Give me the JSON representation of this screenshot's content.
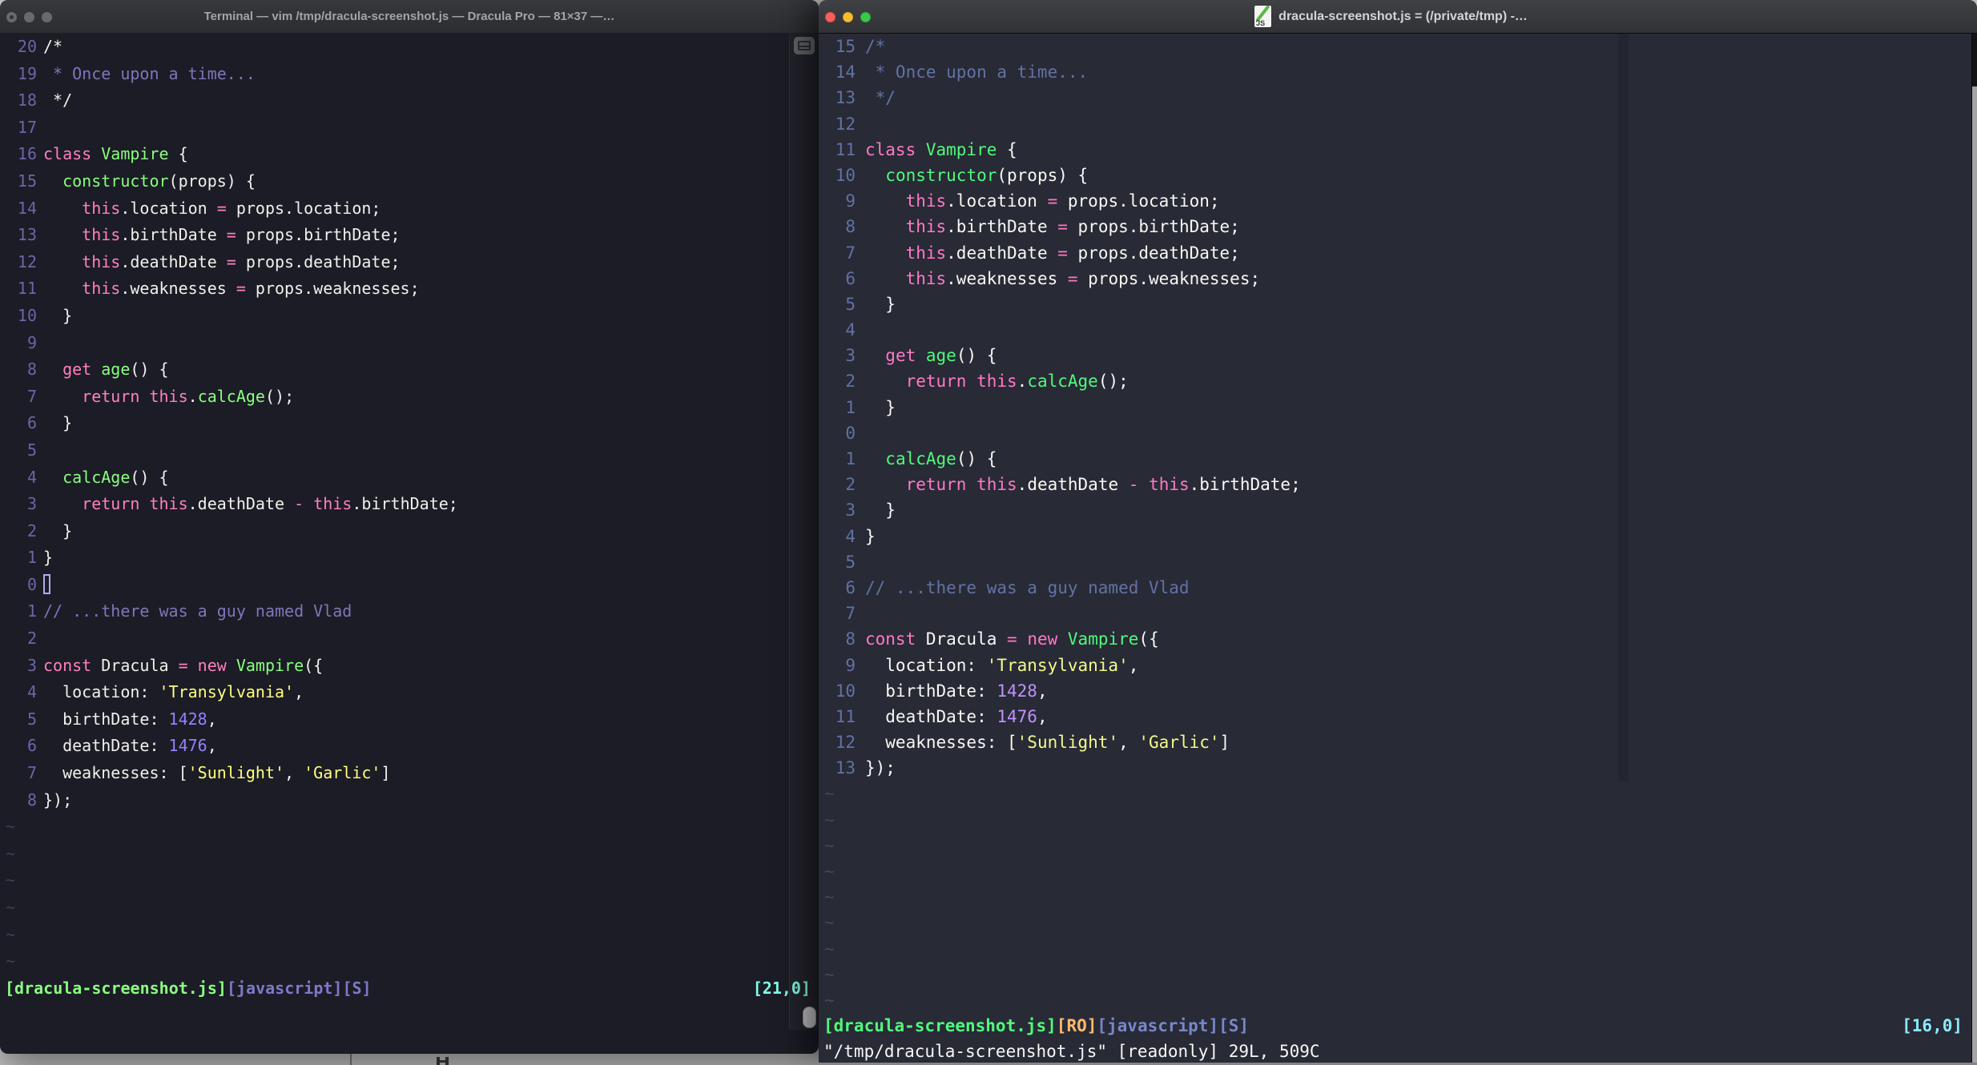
{
  "palette": {
    "lw": {
      "bg": "#1b1c25",
      "fg": "#f1f0ec",
      "pink": "#ff80bf",
      "green": "#8aff80",
      "yellow": "#ffff80",
      "purple": "#9580ff",
      "cyan": "#80ffea",
      "comment": "#7e76bb",
      "line_number": "#6c65a9",
      "tilde": "#3e3f4e",
      "cursor_outline": "#b3a9ee",
      "status_file": "#8aff80",
      "status_meta": "#7e79c9",
      "status_ruler": "#80ffea"
    },
    "rw": {
      "bg": "#282a36",
      "fg": "#f8f8f2",
      "pink": "#ff79c6",
      "green": "#50fa7b",
      "yellow": "#f1fa8c",
      "purple": "#bd93f9",
      "cyan": "#8be9fd",
      "orange": "#ffb86c",
      "comment": "#6272a4",
      "line_number": "#6272a4",
      "tilde": "#44475a",
      "colorcolumn": "#232531",
      "status_file": "#50fa7b",
      "status_meta": "#7787c9",
      "status_ruler": "#8be9fd"
    },
    "traffic_lights": {
      "inactive": "#68696b",
      "red": "#f9605a",
      "yellow": "#f8bd2f",
      "green": "#3bc84a"
    }
  },
  "left_window": {
    "title": "Terminal — vim /tmp/dracula-screenshot.js — Dracula Pro — 81×37 —…",
    "theme": "Dracula Pro",
    "tilde_rows": 6,
    "status": {
      "file": "[dracula-screenshot.js]",
      "meta": "[javascript][S]",
      "ruler": "[21,0]"
    },
    "lines": [
      {
        "n": "20",
        "t": [
          [
            "fg",
            "/*"
          ]
        ]
      },
      {
        "n": "19",
        "t": [
          [
            "comment",
            " * Once upon a time..."
          ]
        ]
      },
      {
        "n": "18",
        "t": [
          [
            "fg",
            " */"
          ]
        ]
      },
      {
        "n": "17",
        "t": []
      },
      {
        "n": "16",
        "t": [
          [
            "pink",
            "class "
          ],
          [
            "green",
            "Vampire"
          ],
          [
            "fg",
            " {"
          ]
        ]
      },
      {
        "n": "15",
        "t": [
          [
            "fg",
            "  "
          ],
          [
            "green",
            "constructor"
          ],
          [
            "fg",
            "(props) {"
          ]
        ]
      },
      {
        "n": "14",
        "t": [
          [
            "fg",
            "    "
          ],
          [
            "pink",
            "this"
          ],
          [
            "fg",
            ".location "
          ],
          [
            "pink",
            "="
          ],
          [
            "fg",
            " props.location;"
          ]
        ]
      },
      {
        "n": "13",
        "t": [
          [
            "fg",
            "    "
          ],
          [
            "pink",
            "this"
          ],
          [
            "fg",
            ".birthDate "
          ],
          [
            "pink",
            "="
          ],
          [
            "fg",
            " props.birthDate;"
          ]
        ]
      },
      {
        "n": "12",
        "t": [
          [
            "fg",
            "    "
          ],
          [
            "pink",
            "this"
          ],
          [
            "fg",
            ".deathDate "
          ],
          [
            "pink",
            "="
          ],
          [
            "fg",
            " props.deathDate;"
          ]
        ]
      },
      {
        "n": "11",
        "t": [
          [
            "fg",
            "    "
          ],
          [
            "pink",
            "this"
          ],
          [
            "fg",
            ".weaknesses "
          ],
          [
            "pink",
            "="
          ],
          [
            "fg",
            " props.weaknesses;"
          ]
        ]
      },
      {
        "n": "10",
        "t": [
          [
            "fg",
            "  }"
          ]
        ]
      },
      {
        "n": "9",
        "t": []
      },
      {
        "n": "8",
        "t": [
          [
            "fg",
            "  "
          ],
          [
            "pink",
            "get "
          ],
          [
            "green",
            "age"
          ],
          [
            "fg",
            "() {"
          ]
        ]
      },
      {
        "n": "7",
        "t": [
          [
            "fg",
            "    "
          ],
          [
            "pink",
            "return "
          ],
          [
            "pink",
            "this"
          ],
          [
            "fg",
            "."
          ],
          [
            "green",
            "calcAge"
          ],
          [
            "fg",
            "();"
          ]
        ]
      },
      {
        "n": "6",
        "t": [
          [
            "fg",
            "  }"
          ]
        ]
      },
      {
        "n": "5",
        "t": []
      },
      {
        "n": "4",
        "t": [
          [
            "fg",
            "  "
          ],
          [
            "green",
            "calcAge"
          ],
          [
            "fg",
            "() {"
          ]
        ]
      },
      {
        "n": "3",
        "t": [
          [
            "fg",
            "    "
          ],
          [
            "pink",
            "return "
          ],
          [
            "pink",
            "this"
          ],
          [
            "fg",
            ".deathDate "
          ],
          [
            "pink",
            "-"
          ],
          [
            "fg",
            " "
          ],
          [
            "pink",
            "this"
          ],
          [
            "fg",
            ".birthDate;"
          ]
        ]
      },
      {
        "n": "2",
        "t": [
          [
            "fg",
            "  }"
          ]
        ]
      },
      {
        "n": "1",
        "t": [
          [
            "fg",
            "}"
          ]
        ]
      },
      {
        "n": "0",
        "t": [],
        "cursor": true
      },
      {
        "n": "1",
        "t": [
          [
            "comment",
            "// ...there was a guy named Vlad"
          ]
        ]
      },
      {
        "n": "2",
        "t": []
      },
      {
        "n": "3",
        "t": [
          [
            "pink",
            "const "
          ],
          [
            "fg",
            "Dracula "
          ],
          [
            "pink",
            "="
          ],
          [
            "fg",
            " "
          ],
          [
            "pink",
            "new "
          ],
          [
            "green",
            "Vampire"
          ],
          [
            "fg",
            "({"
          ]
        ]
      },
      {
        "n": "4",
        "t": [
          [
            "fg",
            "  location: "
          ],
          [
            "yellow",
            "'Transylvania'"
          ],
          [
            "fg",
            ","
          ]
        ]
      },
      {
        "n": "5",
        "t": [
          [
            "fg",
            "  birthDate: "
          ],
          [
            "purple",
            "1428"
          ],
          [
            "fg",
            ","
          ]
        ]
      },
      {
        "n": "6",
        "t": [
          [
            "fg",
            "  deathDate: "
          ],
          [
            "purple",
            "1476"
          ],
          [
            "fg",
            ","
          ]
        ]
      },
      {
        "n": "7",
        "t": [
          [
            "fg",
            "  weaknesses: ["
          ],
          [
            "yellow",
            "'Sunlight'"
          ],
          [
            "fg",
            ", "
          ],
          [
            "yellow",
            "'Garlic'"
          ],
          [
            "fg",
            "]"
          ]
        ]
      },
      {
        "n": "8",
        "t": [
          [
            "fg",
            "});"
          ]
        ]
      }
    ]
  },
  "right_window": {
    "title": "dracula-screenshot.js = (/private/tmp) - VIM",
    "icon_label": "JS",
    "tilde_rows": 9,
    "status": {
      "file": "[dracula-screenshot.js]",
      "ro": "[RO]",
      "meta": "[javascript][S]",
      "ruler": "[16,0]"
    },
    "message": "\"/tmp/dracula-screenshot.js\" [readonly] 29L, 509C",
    "lines": [
      {
        "n": "15",
        "t": [
          [
            "comment",
            "/*"
          ]
        ]
      },
      {
        "n": "14",
        "t": [
          [
            "comment",
            " * Once upon a time..."
          ]
        ]
      },
      {
        "n": "13",
        "t": [
          [
            "comment",
            " */"
          ]
        ]
      },
      {
        "n": "12",
        "t": []
      },
      {
        "n": "11",
        "t": [
          [
            "pink",
            "class "
          ],
          [
            "green",
            "Vampire"
          ],
          [
            "fg",
            " {"
          ]
        ]
      },
      {
        "n": "10",
        "t": [
          [
            "fg",
            "  "
          ],
          [
            "green",
            "constructor"
          ],
          [
            "fg",
            "(props) {"
          ]
        ]
      },
      {
        "n": "9",
        "t": [
          [
            "fg",
            "    "
          ],
          [
            "pink",
            "this"
          ],
          [
            "fg",
            ".location "
          ],
          [
            "pink",
            "="
          ],
          [
            "fg",
            " props.location;"
          ]
        ]
      },
      {
        "n": "8",
        "t": [
          [
            "fg",
            "    "
          ],
          [
            "pink",
            "this"
          ],
          [
            "fg",
            ".birthDate "
          ],
          [
            "pink",
            "="
          ],
          [
            "fg",
            " props.birthDate;"
          ]
        ]
      },
      {
        "n": "7",
        "t": [
          [
            "fg",
            "    "
          ],
          [
            "pink",
            "this"
          ],
          [
            "fg",
            ".deathDate "
          ],
          [
            "pink",
            "="
          ],
          [
            "fg",
            " props.deathDate;"
          ]
        ]
      },
      {
        "n": "6",
        "t": [
          [
            "fg",
            "    "
          ],
          [
            "pink",
            "this"
          ],
          [
            "fg",
            ".weaknesses "
          ],
          [
            "pink",
            "="
          ],
          [
            "fg",
            " props.weaknesses;"
          ]
        ]
      },
      {
        "n": "5",
        "t": [
          [
            "fg",
            "  }"
          ]
        ]
      },
      {
        "n": "4",
        "t": []
      },
      {
        "n": "3",
        "t": [
          [
            "fg",
            "  "
          ],
          [
            "pink",
            "get "
          ],
          [
            "green",
            "age"
          ],
          [
            "fg",
            "() {"
          ]
        ]
      },
      {
        "n": "2",
        "t": [
          [
            "fg",
            "    "
          ],
          [
            "pink",
            "return "
          ],
          [
            "pink",
            "this"
          ],
          [
            "fg",
            "."
          ],
          [
            "green",
            "calcAge"
          ],
          [
            "fg",
            "();"
          ]
        ]
      },
      {
        "n": "1",
        "t": [
          [
            "fg",
            "  }"
          ]
        ]
      },
      {
        "n": "0",
        "t": []
      },
      {
        "n": "1",
        "t": [
          [
            "fg",
            "  "
          ],
          [
            "green",
            "calcAge"
          ],
          [
            "fg",
            "() {"
          ]
        ]
      },
      {
        "n": "2",
        "t": [
          [
            "fg",
            "    "
          ],
          [
            "pink",
            "return "
          ],
          [
            "pink",
            "this"
          ],
          [
            "fg",
            ".deathDate "
          ],
          [
            "pink",
            "-"
          ],
          [
            "fg",
            " "
          ],
          [
            "pink",
            "this"
          ],
          [
            "fg",
            ".birthDate;"
          ]
        ]
      },
      {
        "n": "3",
        "t": [
          [
            "fg",
            "  }"
          ]
        ]
      },
      {
        "n": "4",
        "t": [
          [
            "fg",
            "}"
          ]
        ]
      },
      {
        "n": "5",
        "t": []
      },
      {
        "n": "6",
        "t": [
          [
            "comment",
            "// ...there was a guy named Vlad"
          ]
        ]
      },
      {
        "n": "7",
        "t": []
      },
      {
        "n": "8",
        "t": [
          [
            "pink",
            "const "
          ],
          [
            "fg",
            "Dracula "
          ],
          [
            "pink",
            "="
          ],
          [
            "fg",
            " "
          ],
          [
            "pink",
            "new "
          ],
          [
            "green",
            "Vampire"
          ],
          [
            "fg",
            "({"
          ]
        ]
      },
      {
        "n": "9",
        "t": [
          [
            "fg",
            "  location: "
          ],
          [
            "yellow",
            "'Transylvania'"
          ],
          [
            "fg",
            ","
          ]
        ]
      },
      {
        "n": "10",
        "t": [
          [
            "fg",
            "  birthDate: "
          ],
          [
            "purple",
            "1428"
          ],
          [
            "fg",
            ","
          ]
        ]
      },
      {
        "n": "11",
        "t": [
          [
            "fg",
            "  deathDate: "
          ],
          [
            "purple",
            "1476"
          ],
          [
            "fg",
            ","
          ]
        ]
      },
      {
        "n": "12",
        "t": [
          [
            "fg",
            "  weaknesses: ["
          ],
          [
            "yellow",
            "'Sunlight'"
          ],
          [
            "fg",
            ", "
          ],
          [
            "yellow",
            "'Garlic'"
          ],
          [
            "fg",
            "]"
          ]
        ]
      },
      {
        "n": "13",
        "t": [
          [
            "fg",
            "});"
          ]
        ]
      }
    ]
  }
}
